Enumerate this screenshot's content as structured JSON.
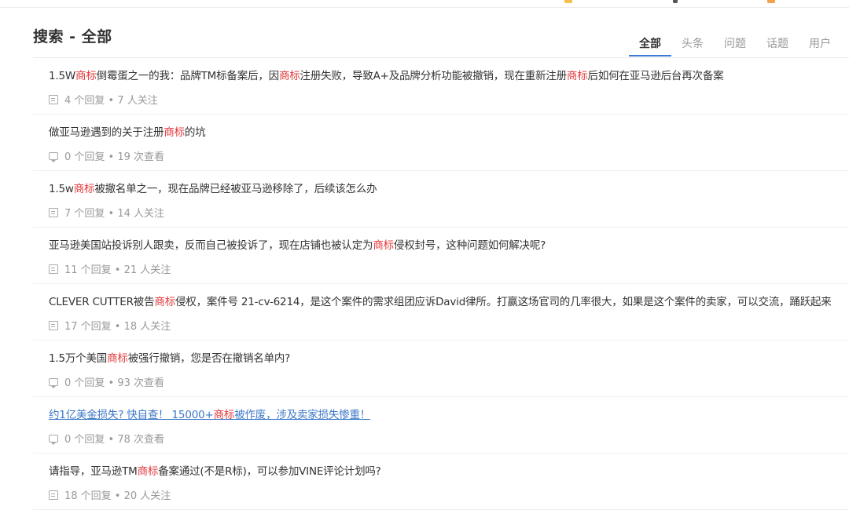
{
  "colors": {
    "accent": "#3c7bd6",
    "highlight": "#e4393c",
    "muted": "#999999"
  },
  "page": {
    "title": "搜索 - 全部"
  },
  "tabs": [
    {
      "label": "全部",
      "active": true
    },
    {
      "label": "头条",
      "active": false
    },
    {
      "label": "问题",
      "active": false
    },
    {
      "label": "话题",
      "active": false
    },
    {
      "label": "用户",
      "active": false
    }
  ],
  "results": [
    {
      "title": [
        {
          "t": "1.5W"
        },
        {
          "t": "商标",
          "hl": true
        },
        {
          "t": "倒霉蛋之一的我：品牌TM标备案后，因"
        },
        {
          "t": "商标",
          "hl": true
        },
        {
          "t": "注册失败，导致A+及品牌分析功能被撤销，现在重新注册"
        },
        {
          "t": "商标",
          "hl": true
        },
        {
          "t": "后如何在亚马逊后台再次备案"
        }
      ],
      "icon": "doc-icon",
      "meta": "4 个回复 • 7 人关注"
    },
    {
      "title": [
        {
          "t": "做亚马逊遇到的关于注册"
        },
        {
          "t": "商标",
          "hl": true
        },
        {
          "t": "的坑"
        }
      ],
      "icon": "chat-icon",
      "meta": "0 个回复 • 19 次查看"
    },
    {
      "title": [
        {
          "t": "1.5w"
        },
        {
          "t": "商标",
          "hl": true
        },
        {
          "t": "被撤名单之一，现在品牌已经被亚马逊移除了，后续该怎么办"
        }
      ],
      "icon": "doc-icon",
      "meta": "7 个回复 • 14 人关注"
    },
    {
      "title": [
        {
          "t": "亚马逊美国站投诉别人跟卖，反而自己被投诉了，现在店铺也被认定为"
        },
        {
          "t": "商标",
          "hl": true
        },
        {
          "t": "侵权封号，这种问题如何解决呢?"
        }
      ],
      "icon": "doc-icon",
      "meta": "11 个回复 • 21 人关注"
    },
    {
      "title": [
        {
          "t": "CLEVER CUTTER被告"
        },
        {
          "t": "商标",
          "hl": true
        },
        {
          "t": "侵权，案件号 21-cv-6214，是这个案件的需求组团应诉David律所。打赢这场官司的几率很大，如果是这个案件的卖家，可以交流，踊跃起来"
        }
      ],
      "icon": "doc-icon",
      "meta": "17 个回复 • 18 人关注"
    },
    {
      "title": [
        {
          "t": "1.5万个美国"
        },
        {
          "t": "商标",
          "hl": true
        },
        {
          "t": "被强行撤销，您是否在撤销名单内?"
        }
      ],
      "icon": "chat-icon",
      "meta": "0 个回复 • 93 次查看"
    },
    {
      "title": [
        {
          "t": "约1亿美金损失? 快自查！ 15000+"
        },
        {
          "t": "商标",
          "hl": true
        },
        {
          "t": "被作废，涉及卖家损失惨重！"
        }
      ],
      "link": true,
      "icon": "chat-icon",
      "meta": "0 个回复 • 78 次查看"
    },
    {
      "title": [
        {
          "t": "请指导，亚马逊TM"
        },
        {
          "t": "商标",
          "hl": true
        },
        {
          "t": "备案通过(不是R标)，可以参加VINE评论计划吗?"
        }
      ],
      "icon": "doc-icon",
      "meta": "18 个回复 • 20 人关注"
    }
  ]
}
